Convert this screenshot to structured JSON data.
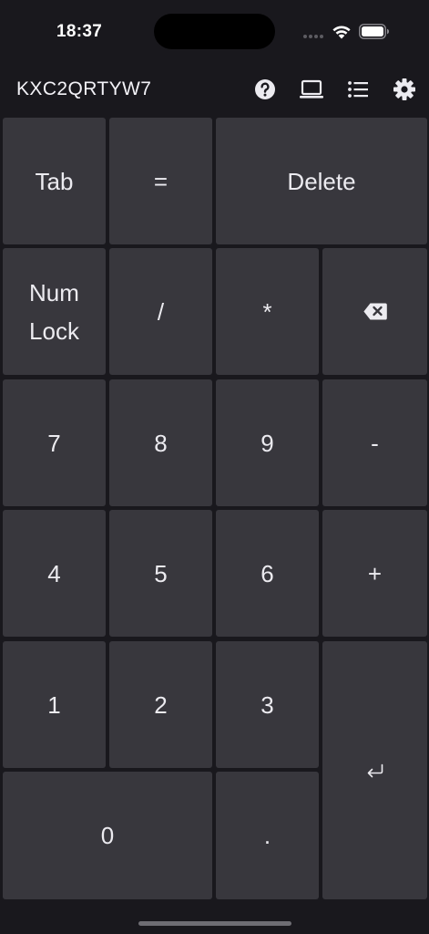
{
  "status_bar": {
    "time": "18:37"
  },
  "header": {
    "device_id": "KXC2QRTYW7",
    "icons": [
      "help-icon",
      "laptop-icon",
      "list-icon",
      "gear-icon"
    ]
  },
  "keypad": {
    "keys": {
      "tab": "Tab",
      "equals": "=",
      "delete": "Delete",
      "num_lock": "Num\nLock",
      "divide": "/",
      "multiply": "*",
      "backspace": "backspace-icon",
      "seven": "7",
      "eight": "8",
      "nine": "9",
      "minus": "-",
      "four": "4",
      "five": "5",
      "six": "6",
      "plus": "+",
      "one": "1",
      "two": "2",
      "three": "3",
      "enter": "enter-icon",
      "zero": "0",
      "decimal": "."
    }
  },
  "colors": {
    "background": "#19181d",
    "key": "#38373d",
    "key_text": "#ecebf0",
    "status_text": "#ffffff"
  }
}
